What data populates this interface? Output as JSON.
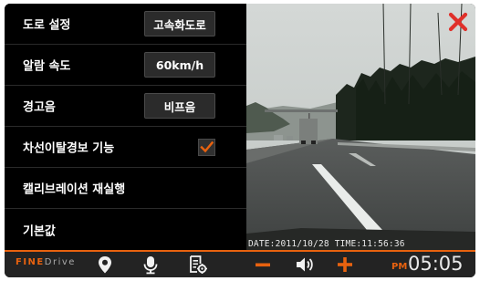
{
  "settings": {
    "road": {
      "label": "도로 설정",
      "value": "고속화도로"
    },
    "alarm_speed": {
      "label": "알람 속도",
      "value": "60km/h"
    },
    "warning_sound": {
      "label": "경고음",
      "value": "비프음"
    },
    "lane_departure": {
      "label": "차선이탈경보 기능",
      "checked": true
    },
    "recalibrate": {
      "label": "캘리브레이션 재실행"
    },
    "defaults": {
      "label": "기본값"
    }
  },
  "video": {
    "timestamp": "DATE:2011/10/28 TIME:11:56:36"
  },
  "bottom_bar": {
    "brand_part1": "FINE",
    "brand_part2": "Drive",
    "ampm": "PM",
    "time": "05:05"
  },
  "icons": {
    "close": "close-icon",
    "location": "map-pin-icon",
    "microphone": "microphone-icon",
    "settings_doc": "settings-document-icon",
    "volume_down": "minus-icon",
    "speaker": "speaker-icon",
    "volume_up": "plus-icon"
  },
  "colors": {
    "accent": "#e8620f",
    "close": "#e0302a",
    "check": "#e8620f"
  }
}
